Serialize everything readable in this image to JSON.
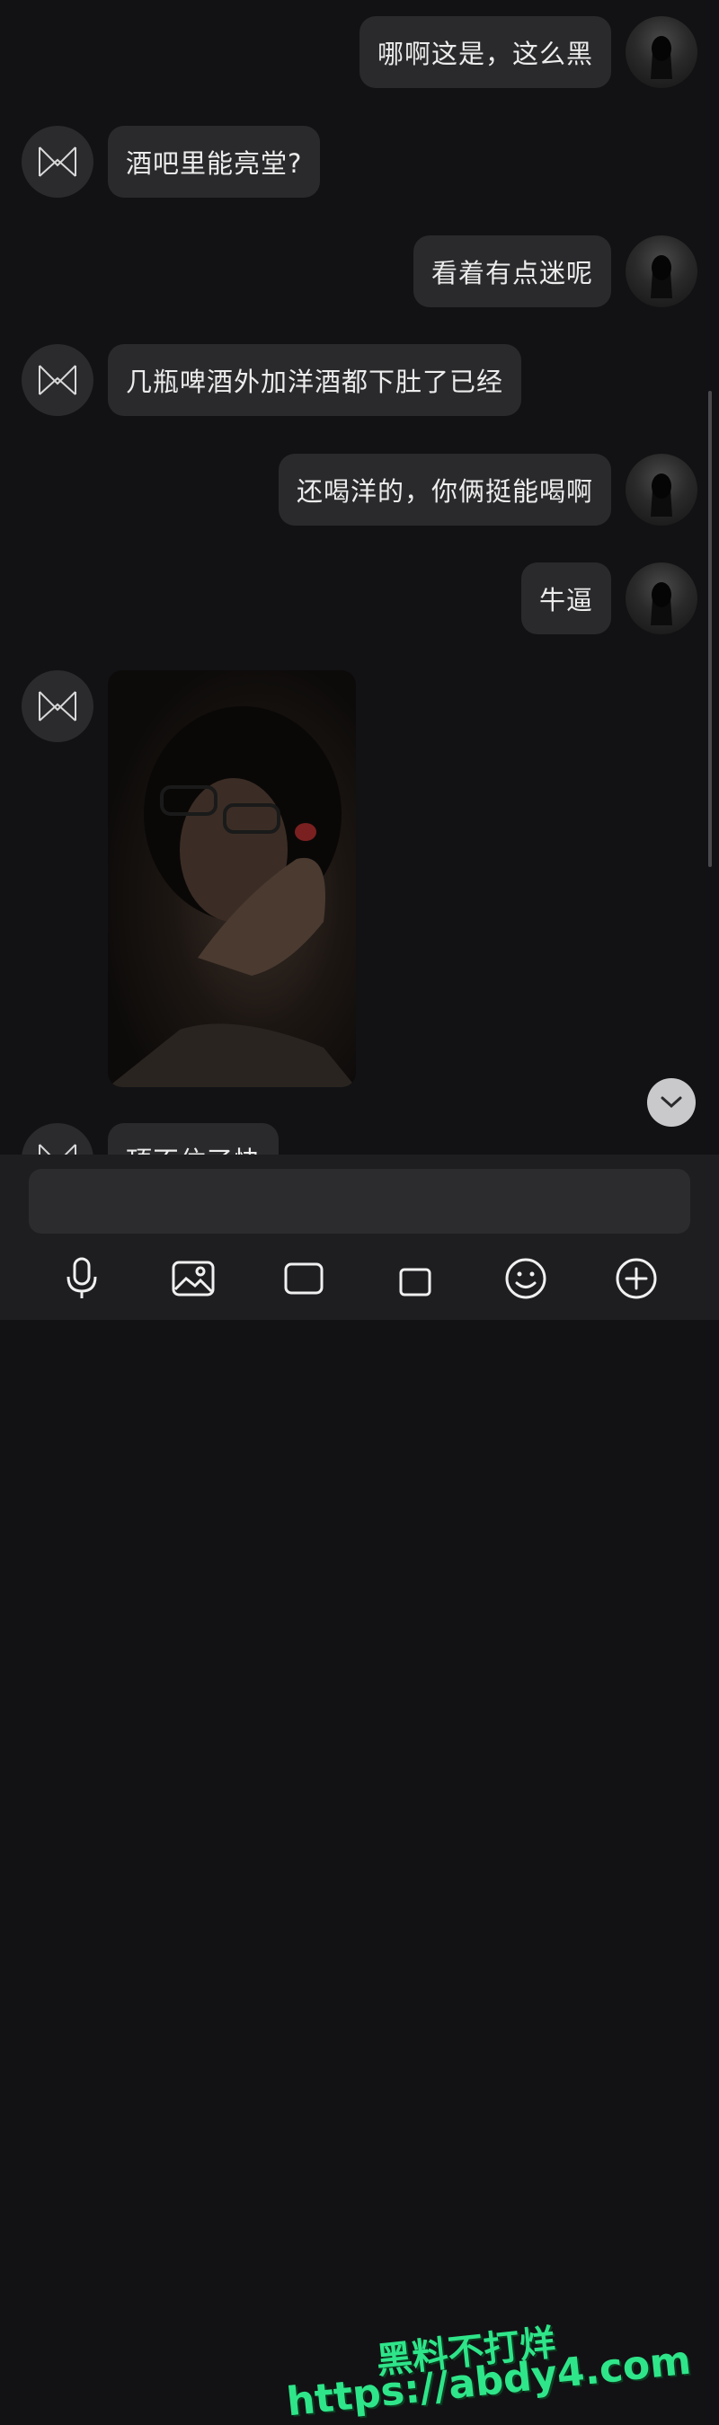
{
  "messages": [
    {
      "text": "哪啊这是，这么黑"
    },
    {
      "text": "酒吧里能亮堂?"
    },
    {
      "text": "看着有点迷呢"
    },
    {
      "text": "几瓶啤酒外加洋酒都下肚了已经"
    },
    {
      "text": "还喝洋的，你俩挺能喝啊"
    },
    {
      "text": "牛逼"
    },
    {
      "text": "顶不住了快"
    }
  ],
  "input": {
    "placeholder": ""
  },
  "watermark": {
    "line1": "黑料不打烊",
    "line2": "https://abdy4.com"
  },
  "toolbar": {
    "icons": [
      "microphone-icon",
      "image-icon",
      "camera-icon",
      "gift-icon",
      "emoji-icon",
      "plus-icon"
    ]
  },
  "colors": {
    "bubble": "#2a2a2d",
    "background": "#121214",
    "watermark": "#2fe58a"
  }
}
